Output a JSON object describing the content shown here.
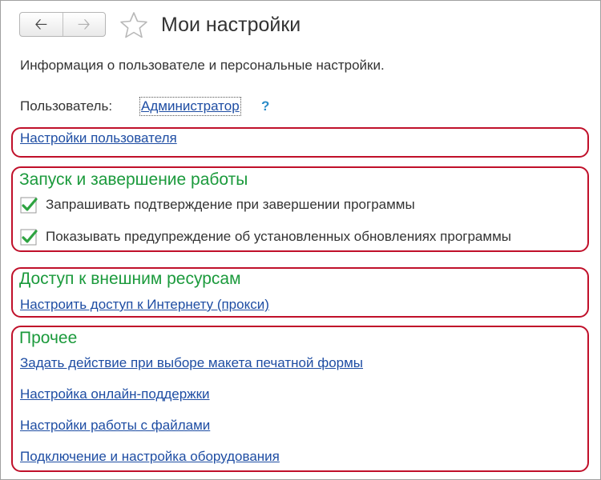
{
  "header": {
    "title": "Мои настройки",
    "back_icon": "arrow-left-icon",
    "forward_icon": "arrow-right-icon",
    "favorite_icon": "star-icon"
  },
  "description": "Информация о пользователе и персональные настройки.",
  "user": {
    "label": "Пользователь:",
    "name": "Администратор",
    "help": "?"
  },
  "groups": {
    "user_settings": {
      "link": "Настройки пользователя"
    },
    "startup": {
      "title": "Запуск и завершение работы",
      "checks": [
        {
          "label": "Запрашивать подтверждение при завершении программы",
          "checked": true
        },
        {
          "label": "Показывать предупреждение об установленных обновлениях программы",
          "checked": true
        }
      ]
    },
    "external": {
      "title": "Доступ к внешним ресурсам",
      "link": "Настроить доступ к Интернету (прокси)"
    },
    "other": {
      "title": "Прочее",
      "links": [
        "Задать действие при выборе макета печатной формы",
        "Настройка онлайн-поддержки",
        "Настройки работы с файлами",
        "Подключение и настройка оборудования"
      ]
    }
  },
  "colors": {
    "accent_green": "#1b9a3c",
    "link_blue": "#1e4da3",
    "highlight_red": "#c0102a",
    "help_blue": "#2b8cc8"
  }
}
